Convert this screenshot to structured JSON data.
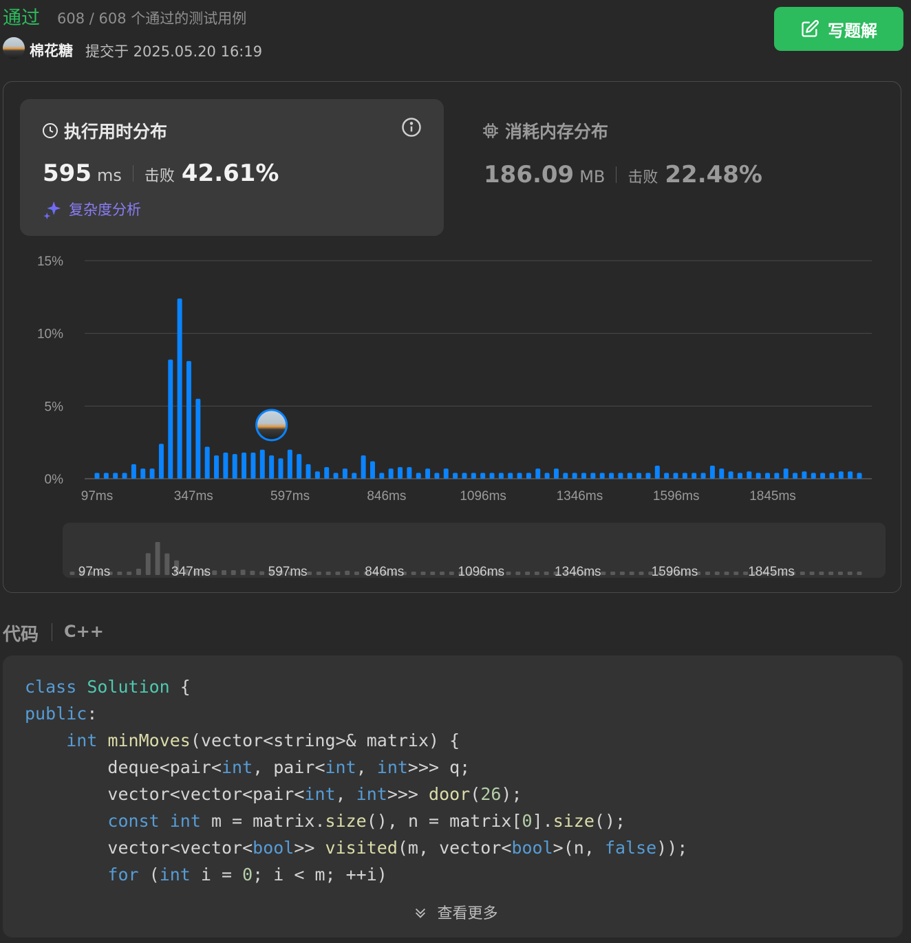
{
  "status": "通过",
  "cases": "608 / 608 个通过的测试用例",
  "user": "棉花糖",
  "submitted": "提交于 2025.05.20 16:19",
  "write_button": "写题解",
  "runtime": {
    "title": "执行用时分布",
    "value": "595",
    "unit": "ms",
    "beat_label": "击败",
    "beat": "42.61%",
    "complexity": "复杂度分析"
  },
  "memory": {
    "title": "消耗内存分布",
    "value": "186.09",
    "unit": "MB",
    "beat_label": "击败",
    "beat": "22.48%"
  },
  "chart_data": {
    "type": "bar",
    "ylabel_ticks": [
      "0%",
      "5%",
      "10%",
      "15%"
    ],
    "ylim": [
      0,
      15
    ],
    "x_tick_labels": [
      "97ms",
      "347ms",
      "597ms",
      "846ms",
      "1096ms",
      "1346ms",
      "1596ms",
      "1845ms"
    ],
    "values": [
      0.4,
      0.4,
      0.4,
      0.4,
      1.0,
      0.7,
      0.7,
      2.4,
      8.2,
      12.4,
      8.1,
      5.5,
      2.2,
      1.6,
      1.8,
      1.7,
      1.8,
      1.8,
      2.0,
      1.6,
      1.4,
      2.0,
      1.7,
      1.0,
      0.5,
      0.8,
      0.4,
      0.7,
      0.4,
      1.6,
      1.2,
      0.4,
      0.7,
      0.8,
      0.8,
      0.4,
      0.7,
      0.4,
      0.7,
      0.4,
      0.4,
      0.4,
      0.4,
      0.4,
      0.4,
      0.4,
      0.4,
      0.4,
      0.7,
      0.4,
      0.7,
      0.4,
      0.4,
      0.4,
      0.4,
      0.4,
      0.4,
      0.4,
      0.4,
      0.4,
      0.4,
      0.9,
      0.4,
      0.4,
      0.4,
      0.4,
      0.4,
      0.9,
      0.7,
      0.5,
      0.4,
      0.5,
      0.4,
      0.4,
      0.4,
      0.7,
      0.4,
      0.5,
      0.4,
      0.4,
      0.4,
      0.5,
      0.5,
      0.4
    ],
    "highlight_index": 19,
    "bar_color": "#0a84ff"
  },
  "code_section": {
    "label": "代码",
    "language": "C++"
  },
  "code_lines": [
    "class Solution {",
    "public:",
    "    int minMoves(vector<string>& matrix) {",
    "        deque<pair<int, pair<int, int>>> q;",
    "        vector<vector<pair<int, int>>> door(26);",
    "        const int m = matrix.size(), n = matrix[0].size();",
    "        vector<vector<bool>> visited(m, vector<bool>(n, false));",
    "        for (int i = 0; i < m; ++i)"
  ],
  "more_label": "查看更多"
}
